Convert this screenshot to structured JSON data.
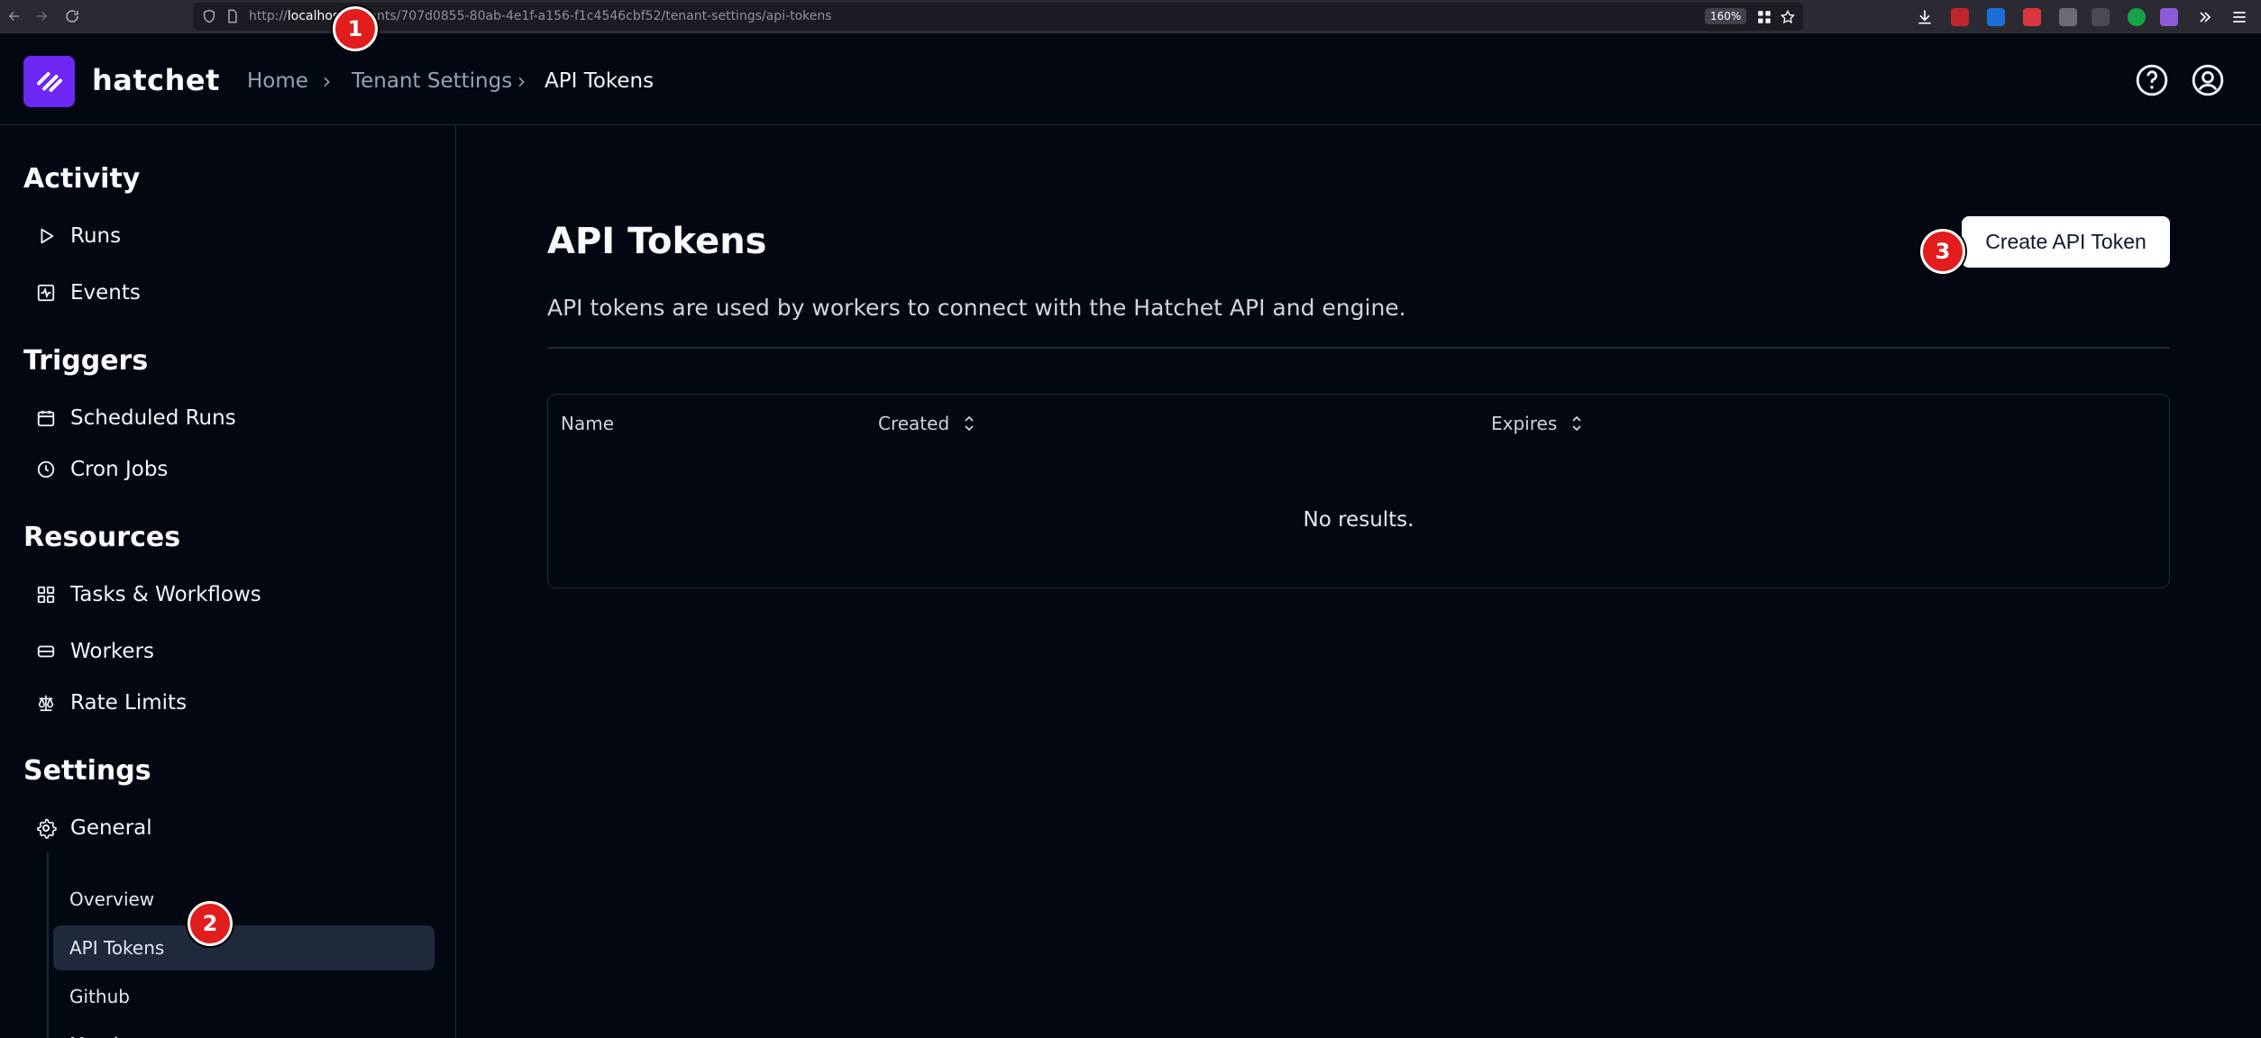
{
  "browser": {
    "url_prefix": "http://",
    "url_host": "localhos",
    "url_rest": "t/tenants/707d0855-80ab-4e1f-a156-f1c4546cbf52/tenant-settings/api-tokens",
    "zoom": "160%"
  },
  "header": {
    "brand": "hatchet",
    "breadcrumbs": [
      "Home",
      "Tenant Settings",
      "API Tokens"
    ],
    "help_icon": "help-circle-icon",
    "account_icon": "user-circle-icon"
  },
  "sidebar": {
    "sections": [
      {
        "title": "Activity",
        "items": [
          {
            "label": "Runs",
            "icon": "play-icon"
          },
          {
            "label": "Events",
            "icon": "activity-icon"
          }
        ]
      },
      {
        "title": "Triggers",
        "items": [
          {
            "label": "Scheduled Runs",
            "icon": "calendar-icon"
          },
          {
            "label": "Cron Jobs",
            "icon": "clock-icon"
          }
        ]
      },
      {
        "title": "Resources",
        "items": [
          {
            "label": "Tasks & Workflows",
            "icon": "grid-icon"
          },
          {
            "label": "Workers",
            "icon": "server-icon"
          },
          {
            "label": "Rate Limits",
            "icon": "scale-icon"
          }
        ]
      },
      {
        "title": "Settings",
        "items": [
          {
            "label": "General",
            "icon": "gear-icon"
          }
        ]
      }
    ],
    "settings_subitems": [
      "Overview",
      "API Tokens",
      "Github",
      "Members"
    ],
    "active_subitem": "API Tokens"
  },
  "main": {
    "title": "API Tokens",
    "description": "API tokens are used by workers to connect with the Hatchet API and engine.",
    "create_button": "Create API Token",
    "table": {
      "columns": [
        "Name",
        "Created",
        "Expires"
      ],
      "empty_message": "No results."
    }
  },
  "markers": [
    "1",
    "2",
    "3"
  ],
  "colors": {
    "background": "#030712",
    "logo": "#6d28f5",
    "marker": "#e11d1d",
    "active_item": "#1e293b"
  }
}
